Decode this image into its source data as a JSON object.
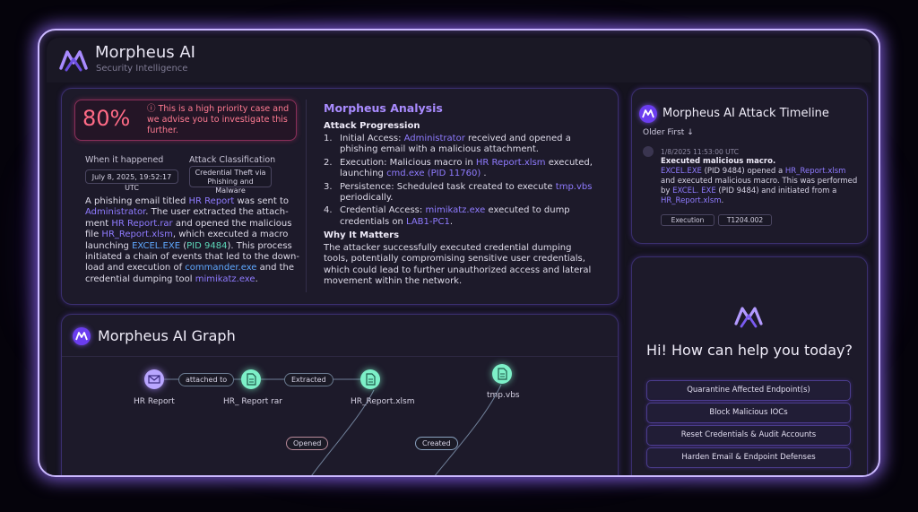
{
  "brand": {
    "name": "Morpheus AI",
    "tagline": "Security Intelligence"
  },
  "case": {
    "priority_pct": "80%",
    "priority_msg": "ⓘ This is a high priority case and we advise you to investigate this further.",
    "when_label": "When it happened",
    "when_value": "July 8, 2025, 19:52:17 UTC",
    "class_label": "Attack Classification",
    "class_value": "Credential Theft via Phishing and Malware",
    "story": {
      "p1": "A phishing email titled ",
      "hr_report": "HR Report",
      "p2": " was sent to ",
      "admin": "Administrator",
      "p3": ". The user extracted the attach­ment ",
      "rar": "HR Report.rar",
      "p4": " and opened the malicious file ",
      "xlsm": "HR_Report.xlsm",
      "p5": ", which executed a macro launching ",
      "excel": "EXCEL.EXE",
      "p6": " (",
      "pid": "PID 9484",
      "p7": "). This process initiated a chain of events that led to the down­load and execution of ",
      "commander": "commander.exe",
      "p8": " and the credential dumping tool ",
      "mimikatz": "mimikatz.exe",
      "p9": "."
    }
  },
  "analysis": {
    "title": "Morpheus Analysis",
    "progression_title": "Attack Progression",
    "steps": [
      {
        "n": "1.",
        "a": "Initial Access: ",
        "h": "Administrator",
        "b": " received and opened a phishing email with a malicious attachment."
      },
      {
        "n": "2.",
        "a": "Execution: Malicious macro in ",
        "h": "HR Report.xlsm",
        "b": " executed, launching ",
        "h2": "cmd.exe (PID 11760)",
        "c": " ."
      },
      {
        "n": "3.",
        "a": "Persistence: Scheduled task created to execute ",
        "h": "tmp.vbs",
        "b": " periodically."
      },
      {
        "n": "4.",
        "a": "Credential Access: ",
        "h": "mimikatz.exe",
        "b": " executed to dump credentials on ",
        "h2": "LAB1-PC1",
        "c": "."
      }
    ],
    "why_title": "Why It Matters",
    "why_text": "The attacker successfully executed credential dumping tools, potentially compromising sensitive user credentials, which could lead to further unauthorized access and lateral move­ment within the network."
  },
  "graph": {
    "title": "Morpheus AI Graph",
    "nodes": [
      {
        "label": "HR Report",
        "icon": "mail-icon"
      },
      {
        "label": "HR_ Report rar",
        "icon": "file-icon"
      },
      {
        "label": "HR_Report.xlsm",
        "icon": "file-icon"
      },
      {
        "label": "tmp.vbs",
        "icon": "file-icon"
      }
    ],
    "edges": [
      "attached to",
      "Extracted",
      "Opened",
      "Created"
    ]
  },
  "timeline": {
    "title": "Morpheus AI Attack Timeline",
    "sort": "Older First ↓",
    "event": {
      "date": "1/8/2025 11:53:00 UTC",
      "heading": "Executed malicious macro.",
      "t1": "EXCEL.EXE",
      "t2": " (PID 9484) opened a ",
      "t3": "HR_Report.xlsm",
      "t4": " and executed malicious macro. This was performed by ",
      "t5": "EXCEL. EXE",
      "t6": " (PID 9484) and initiated from a ",
      "t7": "HR_Report.xlsm",
      "t8": ".",
      "tag1": "Execution",
      "tag2": "T1204.002"
    }
  },
  "assistant": {
    "greeting": "Hi! How can help you today?",
    "actions": [
      "Quarantine Affected Endpoint(s)",
      "Block Malicious IOCs",
      "Reset Credentials & Audit Accounts",
      "Harden Email & Endpoint Defenses"
    ]
  },
  "colors": {
    "accent": "#8f7bff",
    "link": "#5fa8ff",
    "alert": "#ff6b86",
    "node": "#7df0c8"
  }
}
